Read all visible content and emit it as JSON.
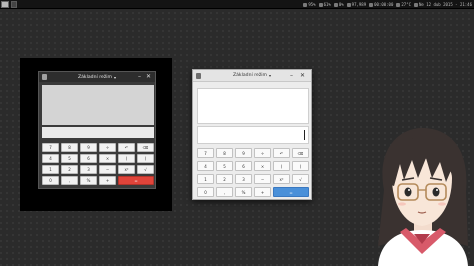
{
  "panel": {
    "tray": [
      {
        "icon": "speaker-icon",
        "text": "95%"
      },
      {
        "icon": "battery-icon",
        "text": "61%"
      },
      {
        "icon": "cpu-icon",
        "text": "0%"
      },
      {
        "icon": "network-icon",
        "text": "97,989"
      },
      {
        "icon": "upload-icon",
        "text": "00:00:00"
      },
      {
        "icon": "temperature-icon",
        "text": "27°C"
      },
      {
        "icon": "clock-icon",
        "text": "Ne 12 dub 2015 - 21:46"
      }
    ]
  },
  "calculator": {
    "title": "Základní režim",
    "chevron": "▾",
    "minimize": "–",
    "close": "✕",
    "keys": [
      {
        "label": "7"
      },
      {
        "label": "8"
      },
      {
        "label": "9"
      },
      {
        "label": "÷"
      },
      {
        "label": "↶"
      },
      {
        "label": "⌫"
      },
      {
        "label": "4"
      },
      {
        "label": "5"
      },
      {
        "label": "6"
      },
      {
        "label": "×"
      },
      {
        "label": "("
      },
      {
        "label": ")"
      },
      {
        "label": "1"
      },
      {
        "label": "2"
      },
      {
        "label": "3"
      },
      {
        "label": "−"
      },
      {
        "label": "x²"
      },
      {
        "label": "√"
      },
      {
        "label": "0"
      },
      {
        "label": ","
      },
      {
        "label": "%"
      },
      {
        "label": "+"
      },
      {
        "label": "="
      }
    ]
  },
  "colors": {
    "desktop": "#2b2b2b",
    "dark_equals": "#e0443a",
    "light_equals": "#4a90d9"
  }
}
